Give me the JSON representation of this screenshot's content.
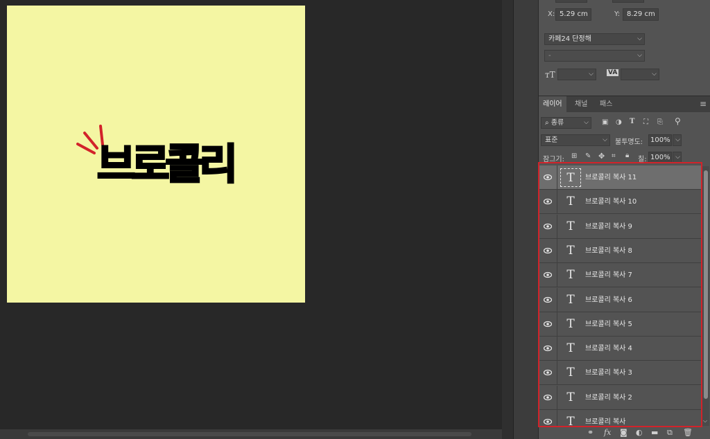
{
  "artboard": {
    "headline": "브로콜리",
    "background_color": "#f4f6a3",
    "burst_color": "#d2232a"
  },
  "properties": {
    "x_label": "X:",
    "x_value": "5.29 cm",
    "y_label": "Y:",
    "y_value": "8.29 cm",
    "font_family": "카페24 단정해",
    "font_style": "-",
    "font_size_icon": "font-size-icon",
    "tracking_icon": "tracking-icon"
  },
  "tabs": [
    {
      "label": "레이어",
      "active": true
    },
    {
      "label": "채널",
      "active": false
    },
    {
      "label": "패스",
      "active": false
    }
  ],
  "filter": {
    "kind_label": "종류"
  },
  "blend": {
    "mode": "표준",
    "opacity_label": "불투명도:",
    "opacity_value": "100%"
  },
  "lock": {
    "label": "잠그기:",
    "fill_label": "칠:",
    "fill_value": "100%"
  },
  "layers": [
    {
      "name": "브로콜리 복사 11",
      "type": "T",
      "selected": true
    },
    {
      "name": "브로콜리 복사 10",
      "type": "T",
      "selected": false
    },
    {
      "name": "브로콜리 복사 9",
      "type": "T",
      "selected": false
    },
    {
      "name": "브로콜리 복사 8",
      "type": "T",
      "selected": false
    },
    {
      "name": "브로콜리 복사 7",
      "type": "T",
      "selected": false
    },
    {
      "name": "브로콜리 복사 6",
      "type": "T",
      "selected": false
    },
    {
      "name": "브로콜리 복사 5",
      "type": "T",
      "selected": false
    },
    {
      "name": "브로콜리 복사 4",
      "type": "T",
      "selected": false
    },
    {
      "name": "브로콜리 복사 3",
      "type": "T",
      "selected": false
    },
    {
      "name": "브로콜리 복사 2",
      "type": "T",
      "selected": false
    },
    {
      "name": "브로콜리 복사",
      "type": "T",
      "selected": false
    }
  ],
  "highlight_color": "#d2232a",
  "bottom_icons": [
    "link-icon",
    "fx-icon",
    "mask-icon",
    "adjustment-icon",
    "folder-icon",
    "new-layer-icon",
    "trash-icon"
  ],
  "fx_label": "fx"
}
